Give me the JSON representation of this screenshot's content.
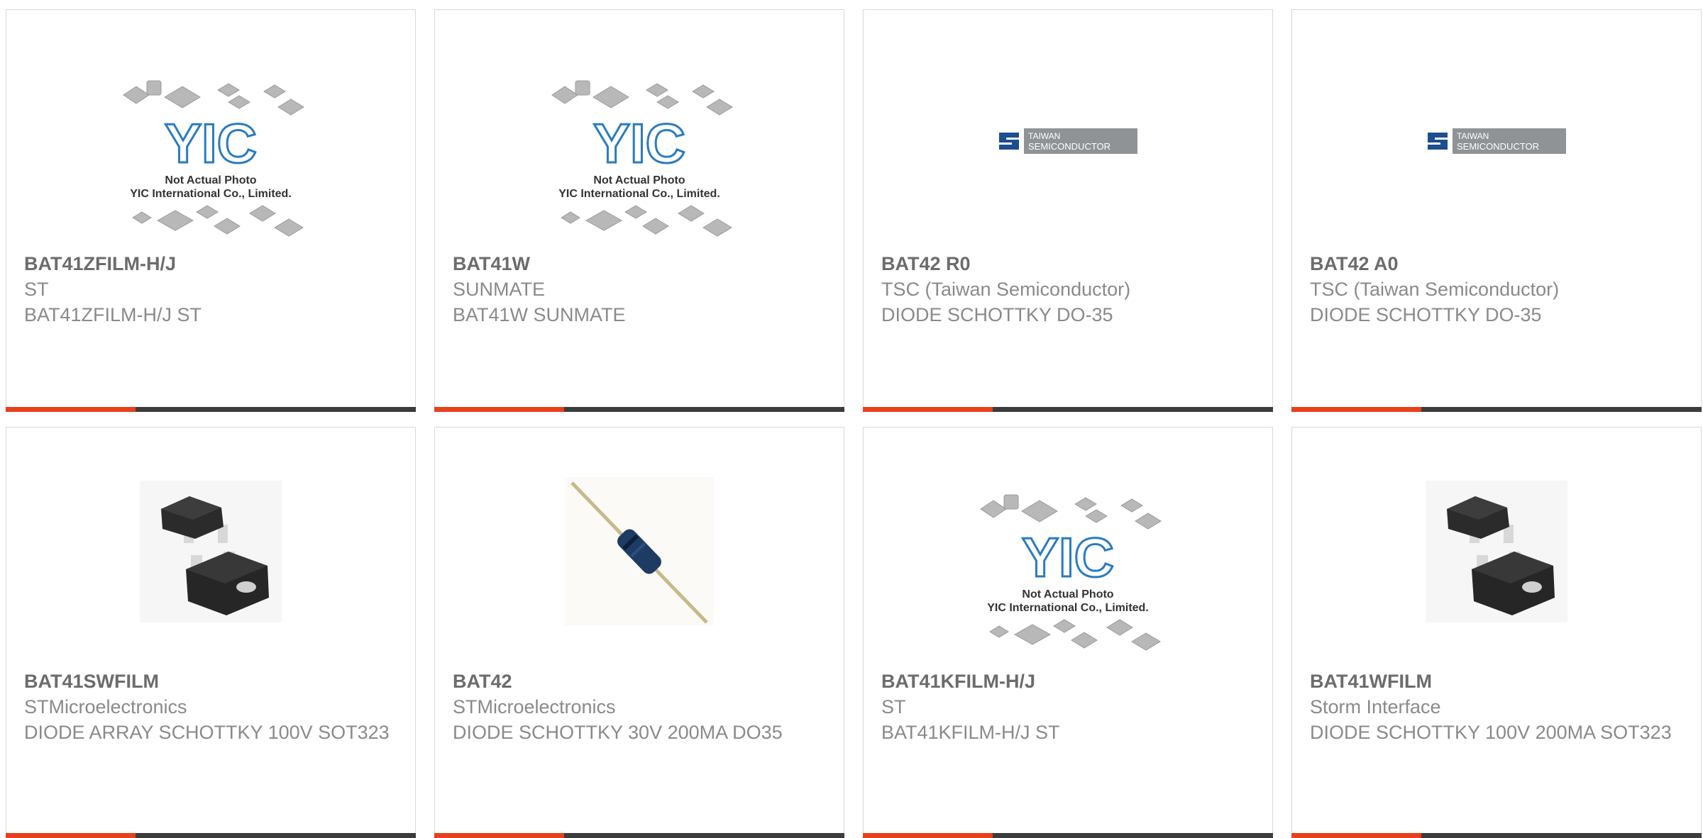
{
  "colors": {
    "accent": "#e8401c",
    "bar": "#3c3c3c",
    "border": "#d9d9d9",
    "text": "#8a8a8a",
    "title": "#6c6c6c"
  },
  "placeholder": {
    "caption_line1": "Not Actual Photo",
    "caption_line2": "YIC International Co., Limited.",
    "logo": "YIC"
  },
  "taiwan_logo": {
    "line1": "TAIWAN",
    "line2": "SEMICONDUCTOR"
  },
  "products": [
    {
      "part": "BAT41ZFILM-H/J",
      "maker": "ST",
      "desc": "BAT41ZFILM-H/J ST",
      "image": "yic-placeholder-image"
    },
    {
      "part": "BAT41W",
      "maker": "SUNMATE",
      "desc": "BAT41W SUNMATE",
      "image": "yic-placeholder-image"
    },
    {
      "part": "BAT42 R0",
      "maker": "TSC (Taiwan Semiconductor)",
      "desc": "DIODE SCHOTTKY DO-35",
      "image": "taiwan-semiconductor-logo"
    },
    {
      "part": "BAT42 A0",
      "maker": "TSC (Taiwan Semiconductor)",
      "desc": "DIODE SCHOTTKY DO-35",
      "image": "taiwan-semiconductor-logo"
    },
    {
      "part": "BAT41SWFILM",
      "maker": "STMicroelectronics",
      "desc": "DIODE ARRAY SCHOTTKY 100V SOT323",
      "image": "sot323-chip-photo"
    },
    {
      "part": "BAT42",
      "maker": "STMicroelectronics",
      "desc": "DIODE SCHOTTKY 30V 200MA DO35",
      "image": "axial-diode-photo"
    },
    {
      "part": "BAT41KFILM-H/J",
      "maker": "ST",
      "desc": "BAT41KFILM-H/J ST",
      "image": "yic-placeholder-image"
    },
    {
      "part": "BAT41WFILM",
      "maker": "Storm Interface",
      "desc": "DIODE SCHOTTKY 100V 200MA SOT323",
      "image": "sot323-chip-photo"
    }
  ]
}
